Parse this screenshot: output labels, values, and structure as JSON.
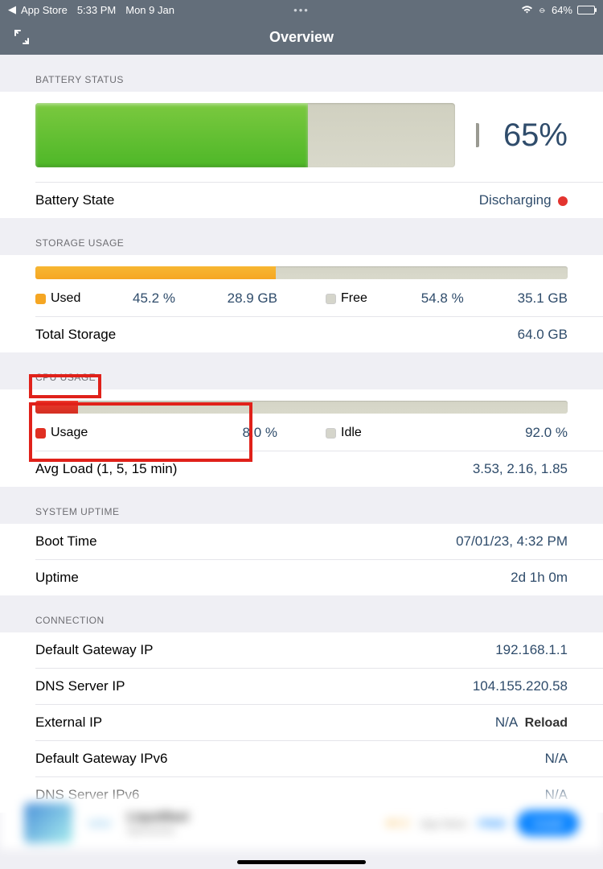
{
  "statusbar": {
    "back_app": "App Store",
    "time": "5:33 PM",
    "date": "Mon 9 Jan",
    "battery_pct": "64%"
  },
  "header": {
    "title": "Overview"
  },
  "battery": {
    "section": "BATTERY STATUS",
    "pct_text": "65%",
    "fill_pct": 65,
    "state_label": "Battery State",
    "state_value": "Discharging"
  },
  "storage": {
    "section": "STORAGE USAGE",
    "used_pct": 45.2,
    "used_label": "Used",
    "used_pct_text": "45.2 %",
    "used_size": "28.9 GB",
    "free_label": "Free",
    "free_pct_text": "54.8 %",
    "free_size": "35.1 GB",
    "total_label": "Total Storage",
    "total_value": "64.0 GB"
  },
  "cpu": {
    "section": "CPU USAGE",
    "usage_pct": 8.0,
    "usage_label": "Usage",
    "usage_text": "8.0 %",
    "idle_label": "Idle",
    "idle_text": "92.0 %",
    "avg_label": "Avg Load (1, 5, 15 min)",
    "avg_value": "3.53, 2.16, 1.85"
  },
  "uptime": {
    "section": "SYSTEM UPTIME",
    "boot_label": "Boot Time",
    "boot_value": "07/01/23, 4:32 PM",
    "uptime_label": "Uptime",
    "uptime_value": "2d 1h 0m"
  },
  "conn": {
    "section": "CONNECTION",
    "gw_label": "Default Gateway IP",
    "gw_value": "192.168.1.1",
    "dns_label": "DNS Server IP",
    "dns_value": "104.155.220.58",
    "ext_label": "External IP",
    "ext_value": "N/A",
    "ext_action": "Reload",
    "gw6_label": "Default Gateway IPv6",
    "gw6_value": "N/A",
    "dns6_label": "DNS Server IPv6",
    "dns6_value": "N/A"
  }
}
